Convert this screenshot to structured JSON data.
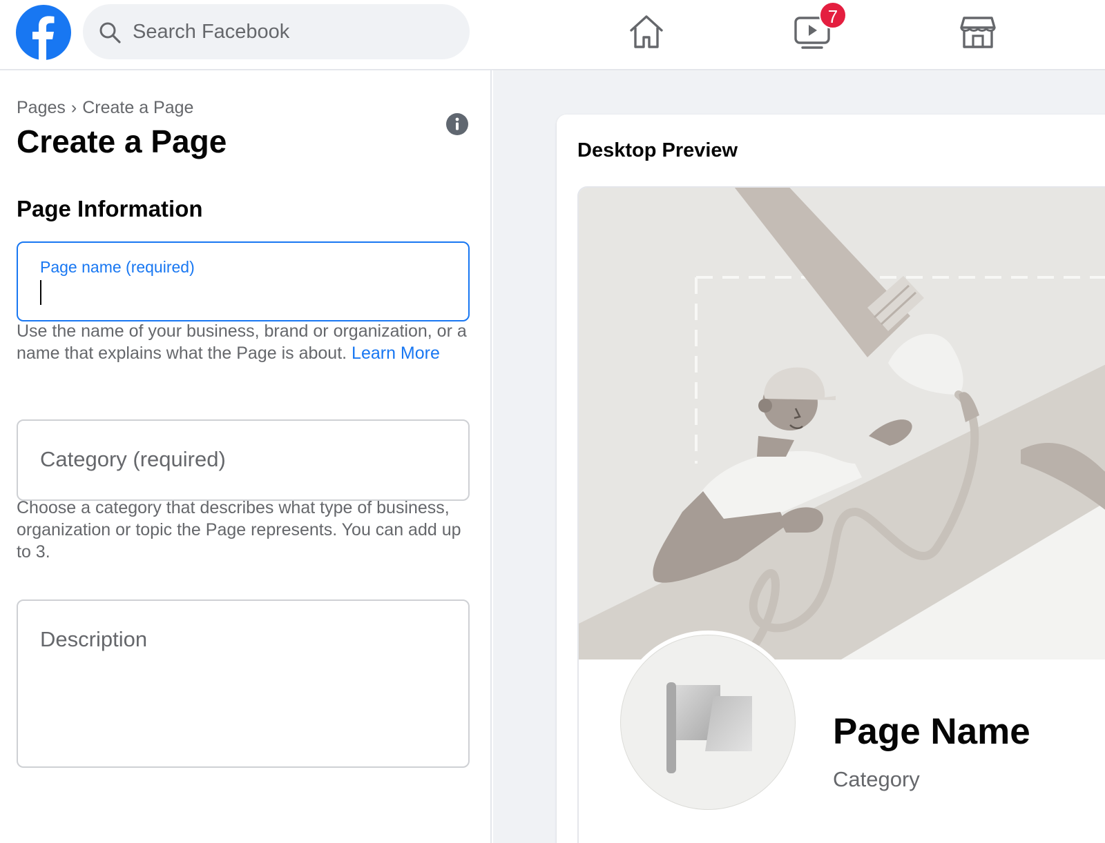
{
  "topbar": {
    "logo": "facebook-logo",
    "search": {
      "placeholder": "Search Facebook",
      "icon": "search-icon"
    },
    "nav": [
      {
        "icon": "home-icon"
      },
      {
        "icon": "watch-icon",
        "badge": "7"
      },
      {
        "icon": "marketplace-icon"
      }
    ],
    "badge_color": "#e41e3f",
    "brand_color": "#1877f2"
  },
  "left": {
    "breadcrumb": {
      "items": [
        "Pages",
        "Create a Page"
      ],
      "separator": "›"
    },
    "title": "Create a Page",
    "section_title": "Page Information",
    "page_name": {
      "label": "Page name (required)",
      "value": ""
    },
    "page_name_help": "Use the name of your business, brand or organization, or a name that explains what the Page is about.",
    "learn_more": "Learn More",
    "category": {
      "placeholder": "Category (required)"
    },
    "category_help": "Choose a category that describes what type of business, organization or topic the Page represents. You can add up to 3.",
    "description": {
      "placeholder": "Description"
    }
  },
  "preview": {
    "title": "Desktop Preview",
    "page_name": "Page Name",
    "category": "Category"
  }
}
